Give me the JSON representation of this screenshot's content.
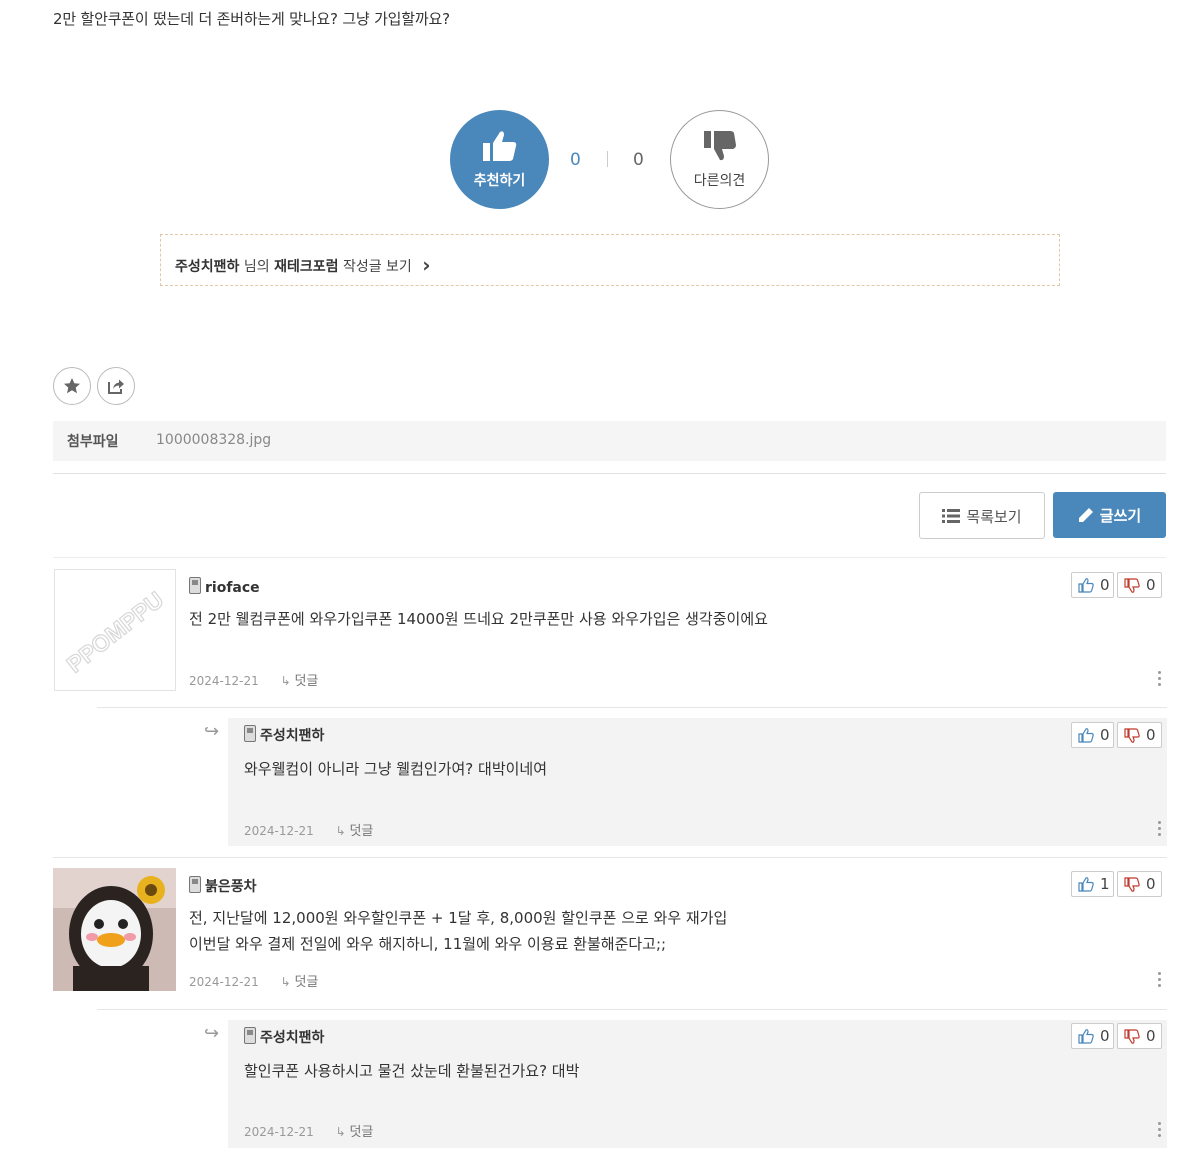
{
  "post": {
    "body_text": "2만 할안쿠폰이 떴는데 더 존버하는게 맞나요? 그냥 가입할까요?"
  },
  "vote": {
    "up_label": "추천하기",
    "down_label": "다른의견",
    "up_count": "0",
    "down_count": "0"
  },
  "author_box": {
    "name": "주성치팬하",
    "suffix": "님의",
    "forum": "재테크포럼",
    "action": "작성글 보기",
    "chevron": "›"
  },
  "attachment": {
    "label": "첨부파일",
    "filename": "1000008328.jpg"
  },
  "buttons": {
    "list_label": "목록보기",
    "write_label": "글쓰기"
  },
  "comments": [
    {
      "author": "rioface",
      "lines": [
        "전 2만 웰컴쿠폰에 와우가입쿠폰 14000원 뜨네요 2만쿠폰만 사용 와우가입은 생각중이에요"
      ],
      "date": "2024-12-21",
      "reply_label": "덧글",
      "likes": "0",
      "dislikes": "0",
      "avatar_text": "PPOMPPU"
    },
    {
      "author": "주성치팬하",
      "lines": [
        "와우웰컴이 아니라 그냥 웰컴인가여? 대박이네여"
      ],
      "date": "2024-12-21",
      "reply_label": "덧글",
      "likes": "0",
      "dislikes": "0"
    },
    {
      "author": "붉은풍차",
      "lines": [
        "전, 지난달에 12,000원 와우할인쿠폰 + 1달 후, 8,000원 할인쿠폰 으로 와우 재가입",
        "이번달 와우 결제 전일에 와우 해지하니, 11월에 와우 이용료 환불해준다고;;"
      ],
      "date": "2024-12-21",
      "reply_label": "덧글",
      "likes": "1",
      "dislikes": "0"
    },
    {
      "author": "주성치팬하",
      "lines": [
        "할인쿠폰 사용하시고 물건 샀눈데 환불된건가요? 대박"
      ],
      "date": "2024-12-21",
      "reply_label": "덧글",
      "likes": "0",
      "dislikes": "0"
    }
  ],
  "icons": {
    "reply_arrow": "↳",
    "nested_arrow": "↪"
  },
  "colors": {
    "accent": "#4a87bb",
    "author_box_border": "#e3c9a5",
    "reply_bg": "#f3f3f3",
    "dislike_red": "#c0392b"
  }
}
